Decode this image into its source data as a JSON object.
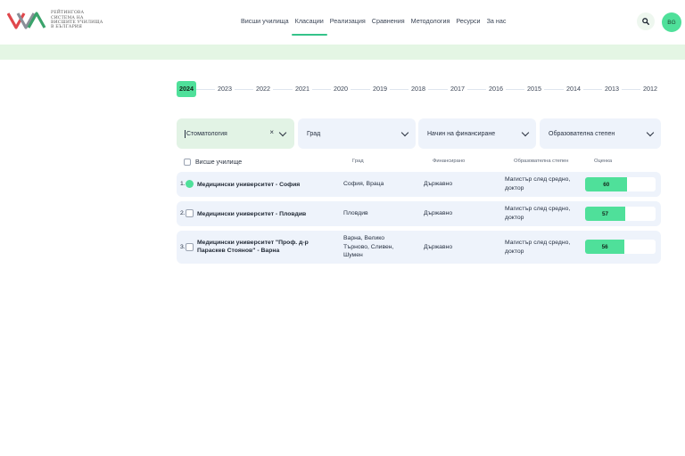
{
  "logo": {
    "lines": [
      "РЕЙТИНГОВА",
      "СИСТЕМА НА",
      "ВИСШИТЕ УЧИЛИЩА",
      "В БЪЛГАРИЯ"
    ]
  },
  "nav": {
    "items": [
      "Висши училища",
      "Класации",
      "Реализация",
      "Сравнения",
      "Методология",
      "Ресурси",
      "За нас"
    ],
    "active": "Класации"
  },
  "header": {
    "lang": "BG",
    "search_icon": "search-icon"
  },
  "years": [
    "2024",
    "2023",
    "2022",
    "2021",
    "2020",
    "2019",
    "2018",
    "2017",
    "2016",
    "2015",
    "2014",
    "2013",
    "2012"
  ],
  "active_year": "2024",
  "filters": {
    "specialty": "Стоматология",
    "city": "Град",
    "funding": "Начин на финансиране",
    "degree": "Образователна степен",
    "clear": "×"
  },
  "table": {
    "headers": {
      "name": "Висше училище",
      "city": "Град",
      "funding": "Финансирано",
      "degree": "Образователна степен",
      "score": "Оценка"
    },
    "rows": [
      {
        "num": "1.",
        "name": [
          "Медицински университет - София"
        ],
        "city": [
          "София, Враца"
        ],
        "funding": "Държавно",
        "degree": [
          "Магистър след средно,",
          "доктор"
        ],
        "score": "60",
        "score_fraction": 0.6,
        "checked": true
      },
      {
        "num": "2.",
        "name": [
          "Медицински университет - Пловдив"
        ],
        "city": [
          "Пловдив"
        ],
        "funding": "Държавно",
        "degree": [
          "Магистър след средно,",
          "доктор"
        ],
        "score": "57",
        "score_fraction": 0.57,
        "checked": false
      },
      {
        "num": "3.",
        "name": [
          "Медицински университет \"Проф. д-р",
          "Параскев Стоянов\" - Варна"
        ],
        "city": [
          "Варна, Велико",
          "Търново, Сливен,",
          "Шумен"
        ],
        "funding": "Държавно",
        "degree": [
          "Магистър след средно,",
          "доктор"
        ],
        "score": "56",
        "score_fraction": 0.56,
        "checked": false
      }
    ]
  },
  "colors": {
    "accent": "#4fe09a",
    "banner": "#e4f6e4",
    "row_bg": "#eef3fb",
    "logo_red": "#e0474c",
    "logo_green": "#3aa36b",
    "logo_gray": "#8a8f98"
  }
}
